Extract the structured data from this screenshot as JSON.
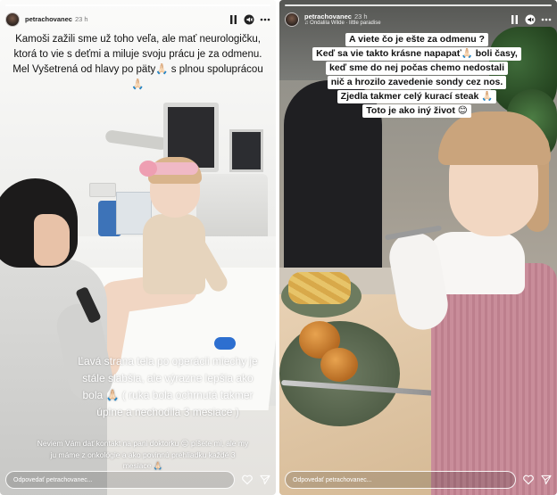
{
  "left_story": {
    "username": "petrachovanec",
    "time": "23 h",
    "caption_top": "Kamoši zažili sme už toho veľa, ale mať neurologičku, ktorá to vie s deťmi a miluje svoju prácu je za odmenu. Mel Vyšetrená od hlavy po päty🙏🏻 s plnou spoluprácou 🙏🏻",
    "caption_middle": "Ľavá strana tela po operácii miechy je stále slabšia, ale výrazne lepšia ako bola 🙏🏻 ( ruka bola ochrnutá takmer úplne a nechodila 3 mesiace )",
    "caption_bottom": "Neviem Vám dať kontakt na pani doktorku 😔 píšete mi, ale my ju máme z onkológie a ako povinnú prehliadku každé 3 mesiace 🙏🏻",
    "reply_placeholder": "Odpovedať petrachovanec..."
  },
  "right_story": {
    "username": "petrachovanec",
    "time": "23 h",
    "music": "♫ Ondalila Wilde · little paradise",
    "caption_lines": [
      "A viete čo je ešte za odmenu ?",
      "Keď sa vie takto krásne napapať🙏🏻 boli časy,",
      "keď sme do nej počas chemo nedostali",
      "nič a hrozilo zavedenie sondy cez nos.",
      "Zjedla takmer celý kurací steak 🙏🏻",
      "Toto je ako iný život 😊"
    ],
    "reply_placeholder": "Odpovedať petrachovanec..."
  },
  "icons": {
    "pause": "pause-icon",
    "mute": "volume-muted-icon",
    "more": "more-icon",
    "like": "heart-icon",
    "share": "send-icon"
  },
  "colors": {
    "caption_box": "#ffffff",
    "caption_text": "#111111",
    "overlay_text": "#ffffff"
  }
}
